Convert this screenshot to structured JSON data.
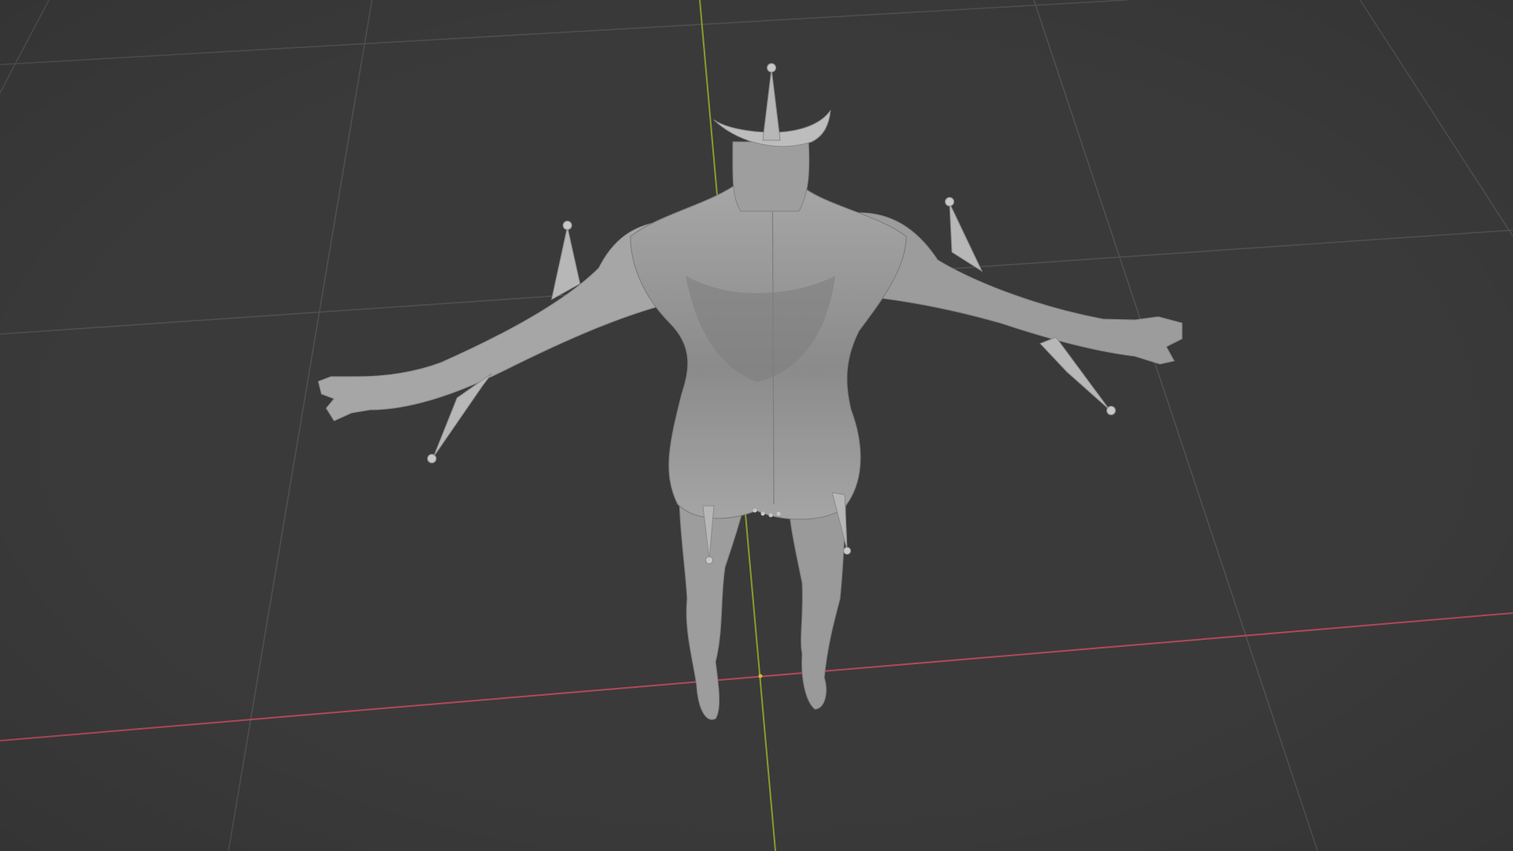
{
  "viewport": {
    "background_color": "#3a3a3a",
    "grid_line_color": "#4e4e4e",
    "x_axis_color": "#c04a5a",
    "y_axis_color": "#8a9a2a",
    "mesh_color": "#a8a8a8",
    "bone_color": "#b9b9b9",
    "view": "perspective-3d",
    "content": "mesh-with-armature"
  },
  "mesh": {
    "name_icon": "humanoid-mesh",
    "shading": "solid"
  },
  "armature": {
    "bones": [
      "head-bone",
      "shoulder-left-bone",
      "shoulder-right-bone",
      "upper-arm-left-bone",
      "upper-arm-right-bone",
      "thigh-left-bone",
      "thigh-right-bone"
    ]
  }
}
